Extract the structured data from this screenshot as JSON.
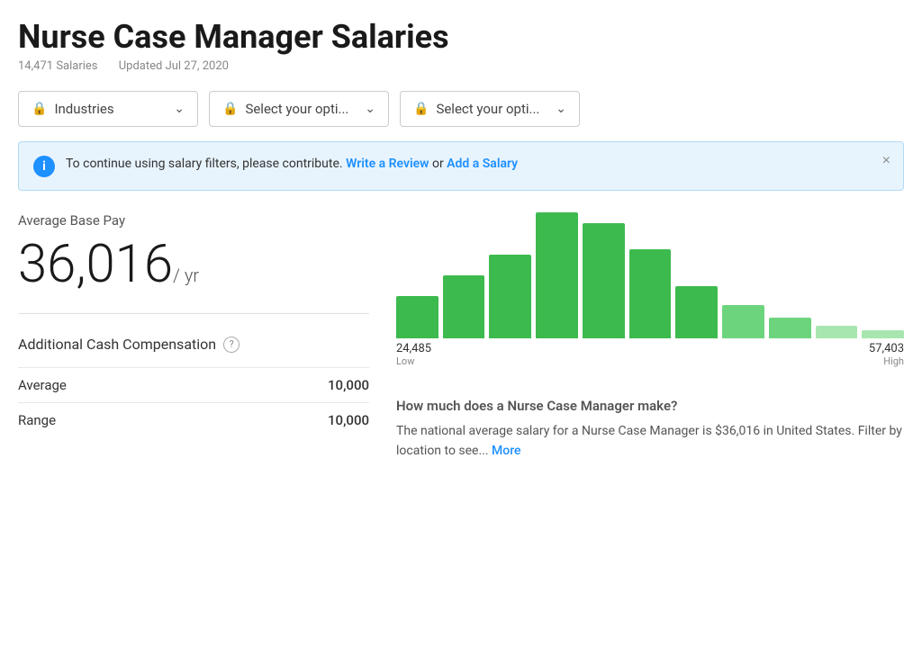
{
  "page": {
    "title": "Nurse Case Manager Salaries",
    "salary_count": "14,471 Salaries",
    "updated": "Updated Jul 27, 2020"
  },
  "filters": [
    {
      "label": "Industries",
      "placeholder": "Industries"
    },
    {
      "label": "Select your opti...",
      "placeholder": "Select your opti..."
    },
    {
      "label": "Select your opti...",
      "placeholder": "Select your opti..."
    }
  ],
  "banner": {
    "text_before": "To continue using salary filters, please contribute.",
    "link1": "Write a Review",
    "text_middle": " or ",
    "link2": "Add a Salary"
  },
  "salary": {
    "avg_base_pay_label": "Average Base Pay",
    "amount": "36,016",
    "per_yr": "/ yr"
  },
  "chart": {
    "bars": [
      40,
      60,
      80,
      120,
      110,
      85,
      50,
      32,
      20,
      12,
      8
    ],
    "low_value": "24,485",
    "high_value": "57,403",
    "low_label": "Low",
    "high_label": "High"
  },
  "additional_cash": {
    "label": "Additional Cash Compensation",
    "rows": [
      {
        "label": "Average",
        "value": "10,000"
      },
      {
        "label": "Range",
        "value": "10,000"
      }
    ]
  },
  "description": {
    "title": "How much does a Nurse Case Manager make?",
    "text": "The national average salary for a Nurse Case Manager is $36,016 in United States. Filter by location to see...",
    "more_label": "More"
  },
  "icons": {
    "lock": "🔒",
    "chevron": "∨",
    "info": "i",
    "close": "×",
    "question": "?"
  }
}
